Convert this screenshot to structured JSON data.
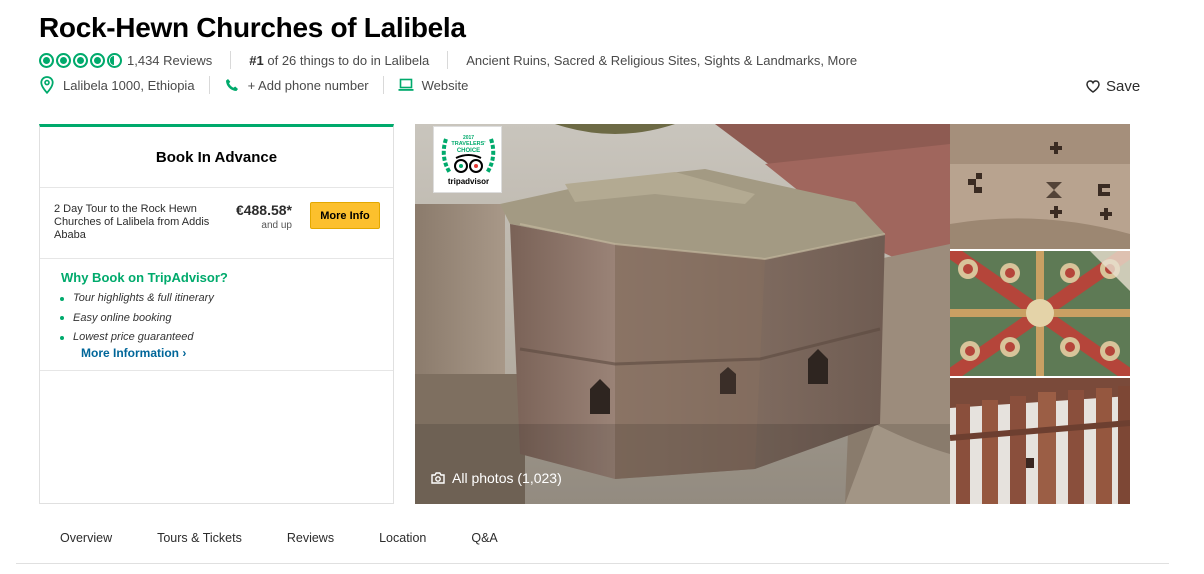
{
  "header": {
    "title": "Rock-Hewn Churches of Lalibela",
    "rating": 4.5,
    "reviews": "1,434 Reviews",
    "rank_num": "#1",
    "rank_text": " of 26 things to do in Lalibela",
    "categories": "Ancient Ruins, Sacred & Religious Sites, Sights & Landmarks, More",
    "address": "Lalibela 1000, Ethiopia",
    "phone": "+ Add phone number",
    "website": "Website",
    "save": "Save"
  },
  "booking": {
    "title": "Book In Advance",
    "tour": {
      "name": "2 Day Tour to the Rock Hewn Churches of Lalibela from Addis Ababa",
      "price": "€488.58*",
      "price_suffix": "and up",
      "button": "More Info"
    },
    "why_title": "Why Book on TripAdvisor?",
    "why_items": [
      "Tour highlights & full itinerary",
      "Easy online booking",
      "Lowest price guaranteed"
    ],
    "more_info": "More Information ›"
  },
  "photos": {
    "badge_year": "2017",
    "badge_line1": "TRAVELERS'",
    "badge_line2": "CHOICE",
    "badge_brand": "tripadvisor",
    "all_photos": "All photos (1,023)"
  },
  "tabs": [
    "Overview",
    "Tours & Tickets",
    "Reviews",
    "Location",
    "Q&A"
  ],
  "colors": {
    "brand_green": "#00aa6c",
    "link_blue": "#006699",
    "button_yellow": "#fcc02d"
  },
  "icons": {
    "location": "map-pin-icon",
    "phone": "phone-icon",
    "website": "laptop-icon",
    "save": "heart-icon",
    "camera": "camera-icon"
  }
}
